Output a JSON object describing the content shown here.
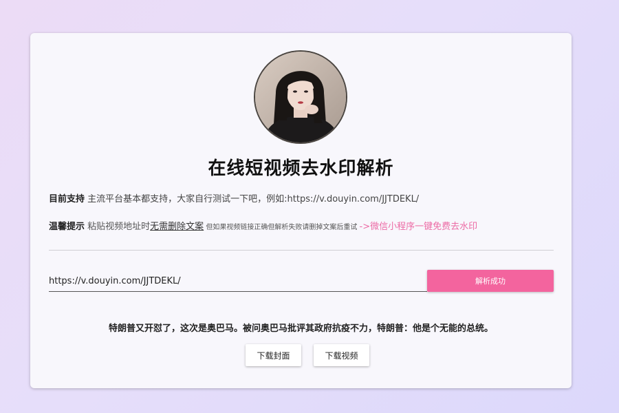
{
  "page": {
    "title": "在线短视频去水印解析"
  },
  "info": {
    "support_label": "目前支持",
    "support_text": " 主流平台基本都支持，大家自行测试一下吧，例如:https://v.douyin.com/JJTDEKL/",
    "tip_label": "温馨提示",
    "tip_text": " 粘贴视频地址时",
    "tip_underline": "无需删除文案",
    "tip_small": " 但如果视频链接正确但解析失败请删掉文案后重试 ",
    "tip_link": "->微信小程序一键免费去水印"
  },
  "form": {
    "url_value": "https://v.douyin.com/JJTDEKL/",
    "parse_button": "解析成功"
  },
  "result": {
    "video_title": "特朗普又开怼了，这次是奥巴马。被问奥巴马批评其政府抗疫不力，特朗普：他是个无能的总统。",
    "download_cover": "下载封面",
    "download_video": "下载视频"
  },
  "colors": {
    "accent": "#f3649e",
    "link": "#ec6ba5"
  },
  "icons": {
    "avatar": "avatar-photo"
  }
}
